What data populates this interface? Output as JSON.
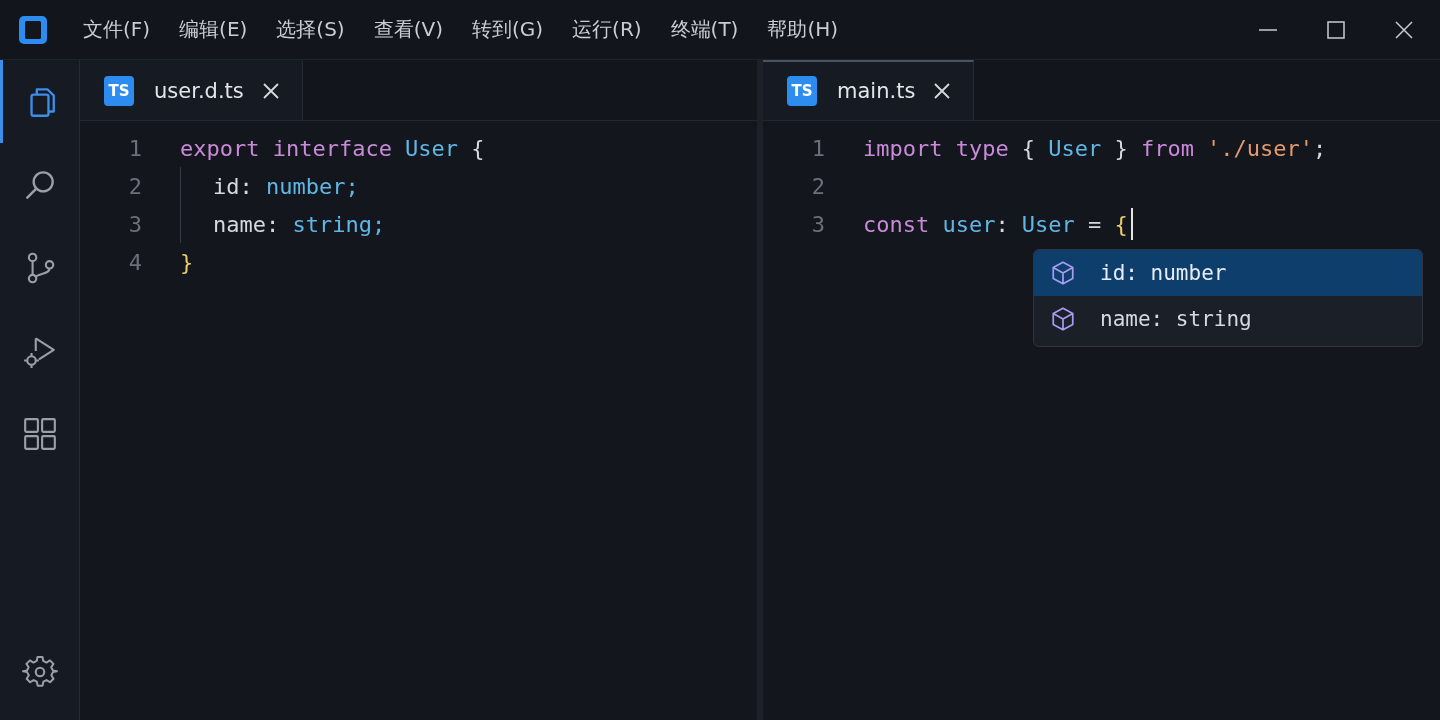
{
  "menu_bar": {
    "items": [
      "文件(F)",
      "编辑(E)",
      "选择(S)",
      "查看(V)",
      "转到(G)",
      "运行(R)",
      "终端(T)",
      "帮助(H)"
    ]
  },
  "activity_bar": {
    "items": [
      {
        "kind": "files",
        "selected": true
      },
      {
        "kind": "search",
        "selected": false
      },
      {
        "kind": "branch",
        "selected": false
      },
      {
        "kind": "run",
        "selected": false
      },
      {
        "kind": "extensions",
        "selected": false
      }
    ],
    "bottom": [
      {
        "kind": "settings",
        "selected": false
      }
    ]
  },
  "editor_groups": [
    {
      "tab": {
        "badge": "TS",
        "label": "user.d.ts",
        "focused": false
      },
      "lines": [
        {
          "number": "1",
          "indented": false,
          "cursor": false,
          "tokens": [
            {
              "kind": "keyword",
              "text": "export"
            },
            {
              "kind": "keyword",
              "text": "interface"
            },
            {
              "kind": "type",
              "text": "User"
            },
            {
              "kind": "plain",
              "text": "{"
            }
          ]
        },
        {
          "number": "2",
          "indented": true,
          "cursor": false,
          "tokens": [
            {
              "kind": "plain",
              "text": "id:"
            },
            {
              "kind": "type",
              "text": "number;"
            }
          ]
        },
        {
          "number": "3",
          "indented": true,
          "cursor": false,
          "tokens": [
            {
              "kind": "plain",
              "text": "name:"
            },
            {
              "kind": "type",
              "text": "string;"
            }
          ]
        },
        {
          "number": "4",
          "indented": false,
          "cursor": false,
          "tokens": [
            {
              "kind": "brace",
              "text": "}"
            }
          ]
        }
      ]
    },
    {
      "tab": {
        "badge": "TS",
        "label": "main.ts",
        "focused": true
      },
      "lines": [
        {
          "number": "1",
          "indented": false,
          "cursor": false,
          "tokens": [
            {
              "kind": "keyword",
              "text": "import"
            },
            {
              "kind": "keyword",
              "text": "type"
            },
            {
              "kind": "plain",
              "text": "{"
            },
            {
              "kind": "type",
              "text": "User"
            },
            {
              "kind": "plain",
              "text": "}"
            },
            {
              "kind": "keyword",
              "text": "from"
            },
            {
              "kind": "string",
              "text": "'./user'"
            },
            {
              "kind": "plain",
              "text": ";",
              "join": true
            }
          ]
        },
        {
          "number": "2",
          "indented": false,
          "cursor": false
        },
        {
          "number": "3",
          "indented": false,
          "cursor": true,
          "tokens": [
            {
              "kind": "keyword",
              "text": "const"
            },
            {
              "kind": "type",
              "text": "user"
            },
            {
              "kind": "plain",
              "text": ":",
              "join": true
            },
            {
              "kind": "type",
              "text": "User"
            },
            {
              "kind": "plain",
              "text": "="
            },
            {
              "kind": "brace",
              "text": "{"
            }
          ]
        }
      ],
      "suggestions": [
        {
          "label": "id: number",
          "selected": true
        },
        {
          "label": "name: string",
          "selected": false
        }
      ]
    }
  ]
}
